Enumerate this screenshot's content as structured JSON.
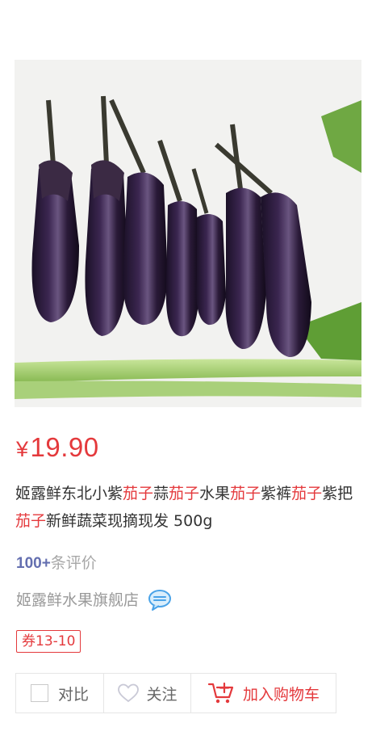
{
  "product": {
    "image_alt": "eggplants",
    "price_currency": "¥",
    "price_value": "19.90",
    "title_segments": [
      {
        "text": "姬露鲜东北小紫",
        "highlight": false
      },
      {
        "text": "茄子",
        "highlight": true
      },
      {
        "text": "蒜",
        "highlight": false
      },
      {
        "text": "茄子",
        "highlight": true
      },
      {
        "text": "水果",
        "highlight": false
      },
      {
        "text": "茄子",
        "highlight": true
      },
      {
        "text": "紫裤",
        "highlight": false
      },
      {
        "text": "茄子",
        "highlight": true
      },
      {
        "text": "紫把",
        "highlight": false
      },
      {
        "text": "茄子",
        "highlight": true
      },
      {
        "text": "新鲜蔬菜现摘现发 500g",
        "highlight": false
      }
    ],
    "comment_count": "100+",
    "comment_label": "条评价",
    "shop_name": "姬露鲜水果旗舰店",
    "coupon": "券13-10"
  },
  "actions": {
    "compare_label": "对比",
    "follow_label": "关注",
    "cart_label": "加入购物车"
  },
  "colors": {
    "accent": "#e4393c",
    "comment_count": "#646fb0",
    "muted": "#999999"
  },
  "icons": [
    "chat-icon",
    "heart-icon",
    "cart-icon",
    "checkbox-icon"
  ]
}
